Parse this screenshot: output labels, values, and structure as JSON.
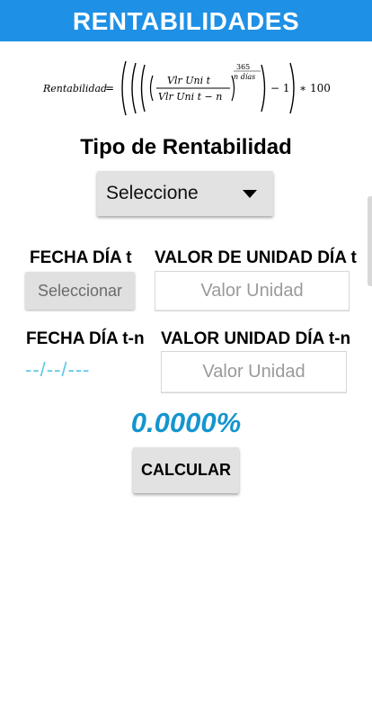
{
  "header": {
    "title": "RENTABILIDADES"
  },
  "formula": {
    "lhs": "Rentabilidad",
    "numerator": "Vlr Uni t",
    "denominator": "Vlr Uni t − n",
    "exp_num": "365",
    "exp_den": "n días",
    "minus_one": "− 1",
    "times_100": "∗ 100"
  },
  "tipo": {
    "title": "Tipo de Rentabilidad",
    "selected": "Seleccione"
  },
  "row_t": {
    "fecha_label": "FECHA DÍA t",
    "valor_label": "VALOR DE UNIDAD DÍA t",
    "date_button": "Seleccionar",
    "value_placeholder": "Valor Unidad"
  },
  "row_tn": {
    "fecha_label": "FECHA DÍA t-n",
    "valor_label": "VALOR UNIDAD DÍA t-n",
    "date_value": "--/--/---",
    "value_placeholder": "Valor Unidad"
  },
  "result": {
    "value": "0.0000%"
  },
  "calc_button": "CALCULAR",
  "colors": {
    "header": "#1e90e6",
    "result": "#1595cf",
    "date_text": "#5ec7ea"
  }
}
